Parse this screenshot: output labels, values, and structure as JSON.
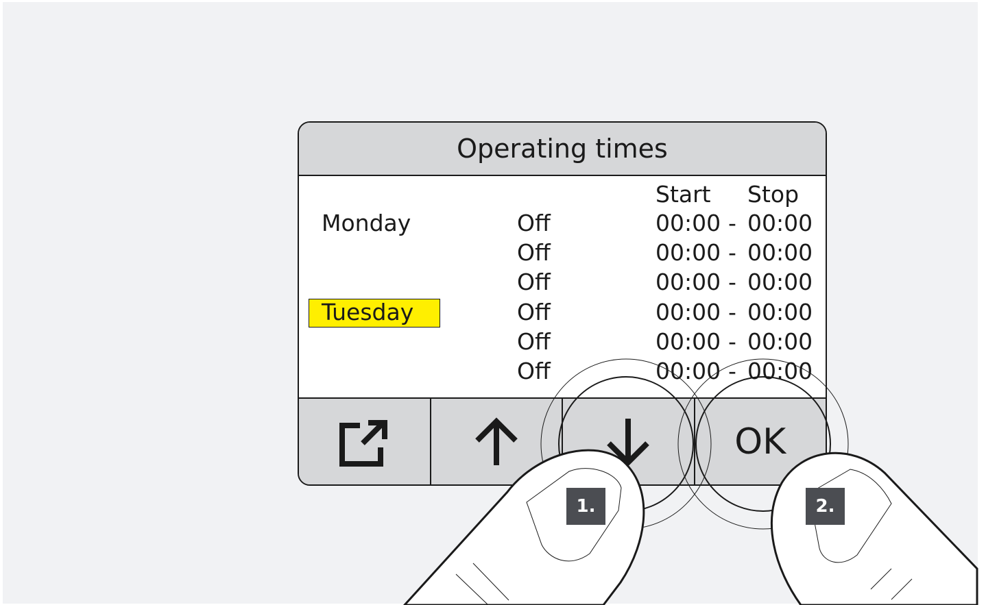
{
  "screen": {
    "title": "Operating times",
    "headers": {
      "start": "Start",
      "stop": "Stop"
    },
    "days": [
      {
        "name": "Monday",
        "selected": false
      },
      {
        "name": "Tuesday",
        "selected": true
      }
    ],
    "rows": [
      {
        "status": "Off",
        "start": "00:00",
        "sep": "-",
        "stop": "00:00"
      },
      {
        "status": "Off",
        "start": "00:00",
        "sep": "-",
        "stop": "00:00"
      },
      {
        "status": "Off",
        "start": "00:00",
        "sep": "-",
        "stop": "00:00"
      },
      {
        "status": "Off",
        "start": "00:00",
        "sep": "-",
        "stop": "00:00"
      },
      {
        "status": "Off",
        "start": "00:00",
        "sep": "-",
        "stop": "00:00"
      },
      {
        "status": "Off",
        "start": "00:00",
        "sep": "-",
        "stop": "00:00"
      }
    ],
    "highlight_color": "#ffef00"
  },
  "buttons": {
    "exit_icon": "exit-icon",
    "up_icon": "arrow-up-icon",
    "down_icon": "arrow-down-icon",
    "ok_label": "OK"
  },
  "steps": {
    "step1": "1.",
    "step2": "2."
  }
}
